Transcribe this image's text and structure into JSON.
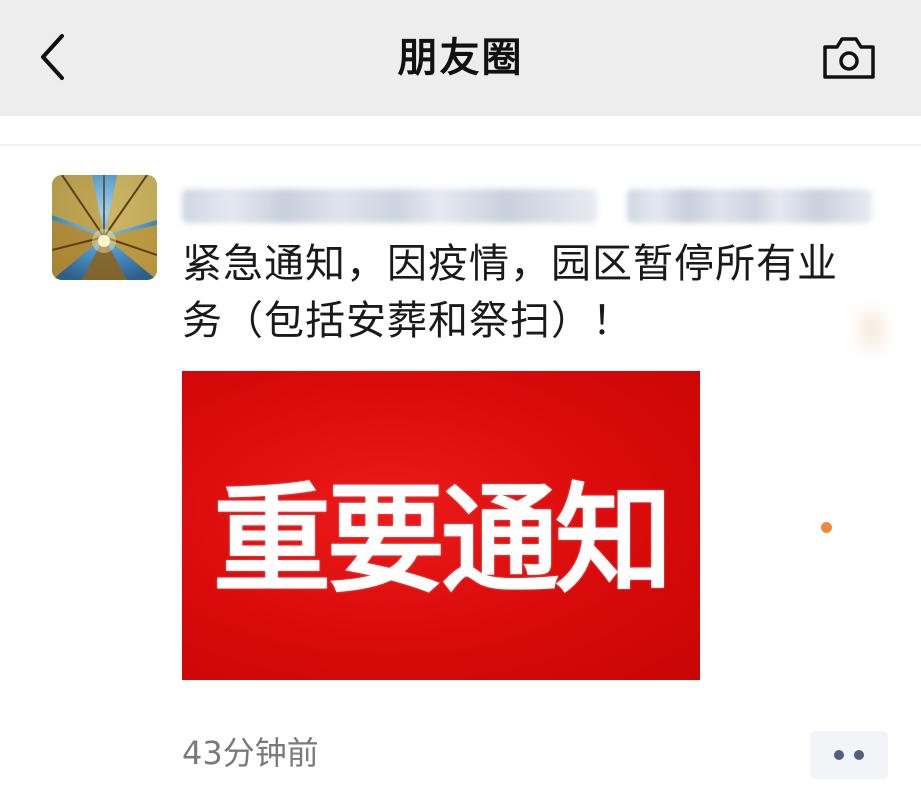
{
  "navbar": {
    "title": "朋友圈",
    "back_icon": "chevron-left-icon",
    "camera_icon": "camera-icon",
    "background": "#ededed"
  },
  "post": {
    "avatar_icon": "tree-photo-avatar",
    "text": "紧急通知，因疫情，园区暂停所有业务（包括安葬和祭扫）！",
    "image": {
      "text": "重要通知",
      "background": "#d90a0a"
    },
    "timestamp": "43分钟前",
    "more_icon": "more-dots-icon"
  }
}
